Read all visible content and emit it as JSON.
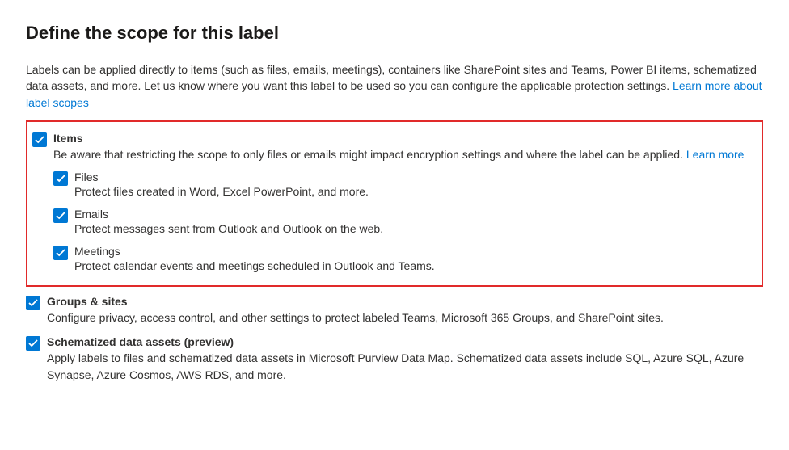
{
  "title": "Define the scope for this label",
  "intro_text": "Labels can be applied directly to items (such as files, emails, meetings), containers like SharePoint sites and Teams, Power BI items, schematized data assets, and more. Let us know where you want this label to be used so you can configure the applicable protection settings. ",
  "intro_link": "Learn more about label scopes",
  "scopes": {
    "items": {
      "label": "Items",
      "desc": "Be aware that restricting the scope to only files or emails might impact encryption settings and where the label can be applied. ",
      "learn_more": "Learn more",
      "checked": true,
      "sub": [
        {
          "label": "Files",
          "desc": "Protect files created in Word, Excel PowerPoint, and more.",
          "checked": true
        },
        {
          "label": "Emails",
          "desc": "Protect messages sent from Outlook and Outlook on the web.",
          "checked": true
        },
        {
          "label": "Meetings",
          "desc": "Protect calendar events and meetings scheduled in Outlook and Teams.",
          "checked": true
        }
      ]
    },
    "groups": {
      "label": "Groups & sites",
      "desc": "Configure privacy, access control, and other settings to protect labeled Teams, Microsoft 365 Groups, and SharePoint sites.",
      "checked": true
    },
    "schematized": {
      "label": "Schematized data assets (preview)",
      "desc": "Apply labels to files and schematized data assets in Microsoft Purview Data Map. Schematized data assets include SQL, Azure SQL, Azure Synapse, Azure Cosmos, AWS RDS, and more.",
      "checked": true
    }
  }
}
